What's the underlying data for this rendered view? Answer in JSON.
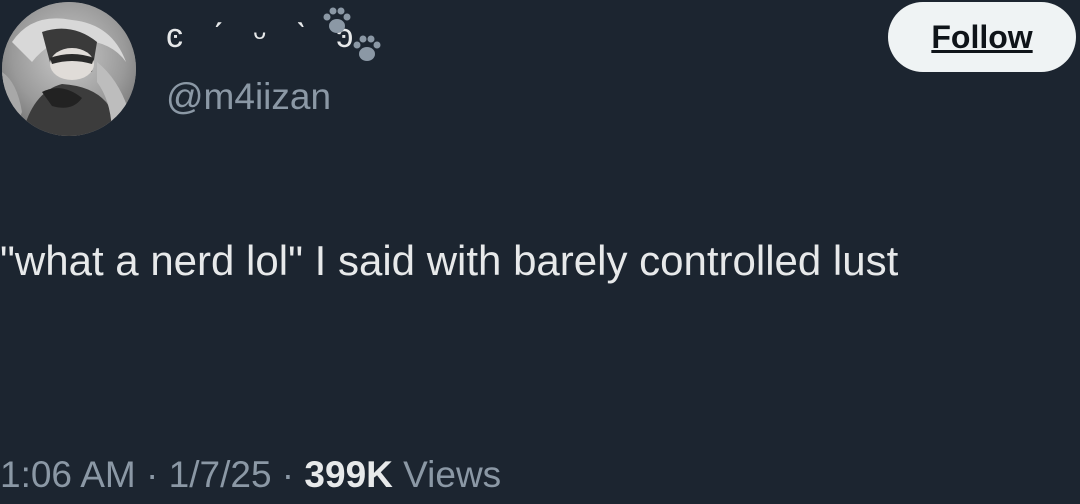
{
  "author": {
    "display_name": "ͼ ˊ ᵕ ˋ ͽ",
    "handle": "@m4iizan",
    "avatar_icon": "avatar-image",
    "name_decorations": [
      "paw-print-icon",
      "paw-print-icon"
    ]
  },
  "follow_button": {
    "label": "Follow"
  },
  "tweet": {
    "text": "\"what a nerd lol\" I said with barely controlled lust",
    "time": "1:06 AM",
    "separator": " · ",
    "date": "1/7/25",
    "views_count": "399K",
    "views_label": " Views"
  },
  "colors": {
    "background": "#1c2530",
    "primary_text": "#e7e9ea",
    "secondary_text": "#8b98a5",
    "button_bg": "#eff3f4",
    "button_text": "#0f1419"
  }
}
